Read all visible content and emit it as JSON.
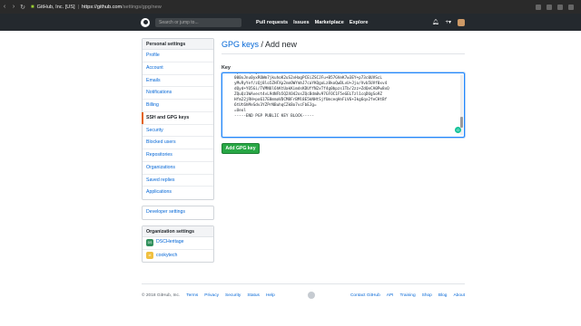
{
  "browser": {
    "site_label": "GitHub, Inc. [US]",
    "url_host": "https://github.com",
    "url_path": "/settings/gpg/new"
  },
  "header": {
    "search_placeholder": "Search or jump to...",
    "nav": [
      "Pull requests",
      "Issues",
      "Marketplace",
      "Explore"
    ],
    "icons": [
      "bell-icon",
      "plus-icon",
      "avatar"
    ]
  },
  "sidebar": {
    "personal_heading": "Personal settings",
    "items": [
      "Profile",
      "Account",
      "Emails",
      "Notifications",
      "Billing",
      "SSH and GPG keys",
      "Security",
      "Blocked users",
      "Repositories",
      "Organizations",
      "Saved replies",
      "Applications"
    ],
    "selected": "SSH and GPG keys",
    "developer": "Developer settings",
    "org_heading": "Organization settings",
    "orgs": [
      {
        "name": "DSCHeritage",
        "avatar": "DS"
      },
      {
        "name": "cookytech",
        "avatar": "ct"
      }
    ]
  },
  "main": {
    "title_link": "GPG keys",
    "title_rest": " / Add new",
    "key_label": "Key",
    "key_value": "lpHJ+nQEkj/5eBF1BvH3rGoVTYdGnh1B6zKZP29w6b9PUQMYdzi9Mk+ZWOFrk7\n000xJnu0yxROWm7jkuhoK2uS2vHagPCEiZSCJFu+B57GVeK7w3EY+p73c0UVScL\nyMvRyYef/zQj8lo5ZHFXp2nmOWYmhJ7caYKQgoLz8koQwDLvU+Jjo/Vvb5UVf0xv4\ndQyd+YO5Gi/TVMNUl6hKtUakKimdsKDUffN2xTf4g0bpzs1Tb/2zz+ZdQeCA0Pw8xQ\nZQuQz1WAvest4vL9dNFb5Q2XO42osZQcBdm8v97GFOC1F5eGELTzl1cqDUgSo9Z\nHfm22jRH+po617E8mmaVDCM8FrBMl8E5kNHtSjfUmceqHnFLV6+Ikg6qx2feCHtBf\n6tUt6hMeSdv3YZPrNBuhqCZkBo7vcFbEJg=\n=Ueol\n-----END PGP PUBLIC KEY BLOCK-----",
    "button_label": "Add GPG key"
  },
  "footer": {
    "copyright": "© 2018 GitHub, Inc.",
    "left_links": [
      "Terms",
      "Privacy",
      "Security",
      "Status",
      "Help"
    ],
    "right_links": [
      "Contact GitHub",
      "API",
      "Training",
      "Shop",
      "Blog",
      "About"
    ]
  }
}
